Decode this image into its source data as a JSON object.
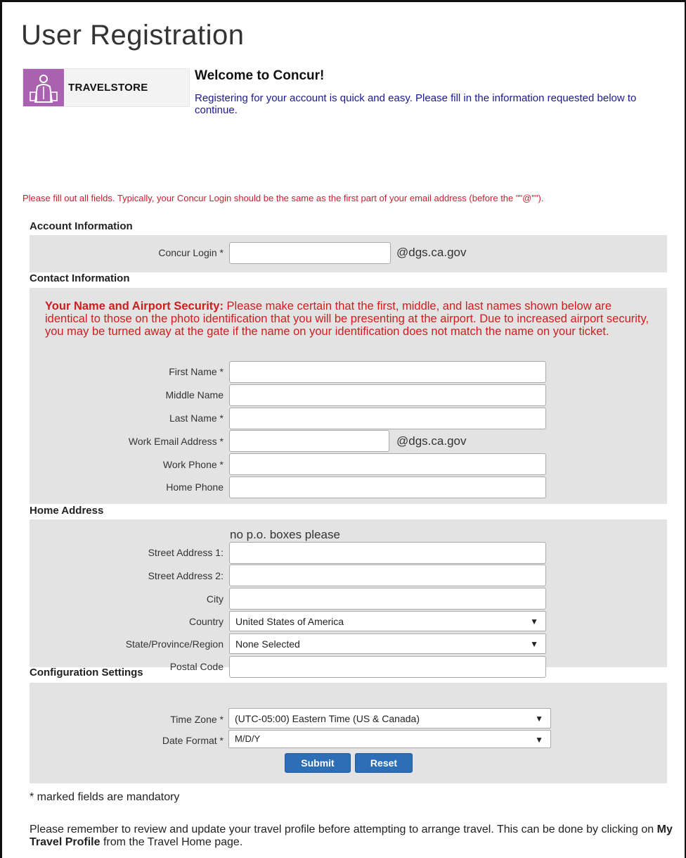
{
  "page": {
    "title": "User Registration"
  },
  "logo": {
    "text": "TRAVELSTORE"
  },
  "welcome": {
    "title": "Welcome to Concur!",
    "text": "Registering for your account is quick and easy. Please fill in the information requested below to continue."
  },
  "notice": "Please fill out all fields. Typically, your Concur Login should be the same as the first part of your email address (before the \"\"@\"\").",
  "account": {
    "section_title": "Account Information",
    "login_label": "Concur Login *",
    "login_value": "",
    "domain": "@dgs.ca.gov"
  },
  "contact": {
    "section_title": "Contact Information",
    "security_heading": "Your Name and Airport Security:",
    "security_text": " Please make certain that the first, middle, and last names shown below are identical to those on the photo identification that you will be presenting at the airport. Due to increased airport security, you may be turned away at the gate if the name on your identification does not match the name on your ticket.",
    "first_name_label": "First Name *",
    "middle_name_label": "Middle Name",
    "last_name_label": "Last Name *",
    "email_label": "Work Email Address *",
    "email_domain": "@dgs.ca.gov",
    "work_phone_label": "Work Phone *",
    "home_phone_label": "Home Phone"
  },
  "address": {
    "section_title": "Home Address",
    "hint": "no p.o. boxes please",
    "street1_label": "Street Address 1:",
    "street2_label": "Street Address 2:",
    "city_label": "City",
    "country_label": "Country",
    "country_value": "United States of America",
    "state_label": "State/Province/Region",
    "state_value": "None Selected",
    "postal_label": "Postal Code"
  },
  "config": {
    "section_title": "Configuration Settings",
    "timezone_label": "Time Zone *",
    "timezone_value": "(UTC-05:00) Eastern Time (US & Canada)",
    "dateformat_label": "Date Format *",
    "dateformat_value": "M/D/Y",
    "submit_label": "Submit",
    "reset_label": "Reset"
  },
  "footer": {
    "mandatory_note": "* marked fields are mandatory",
    "reminder_before": "Please remember to review and update your travel profile before attempting to arrange travel. This can be done by clicking on ",
    "reminder_link": "My Travel Profile",
    "reminder_after": " from the Travel Home page."
  },
  "colors": {
    "accent": "#2c6fb6",
    "warning": "#cf1d1d",
    "logo_purple": "#a862b0",
    "panel": "#e3e3e3"
  }
}
